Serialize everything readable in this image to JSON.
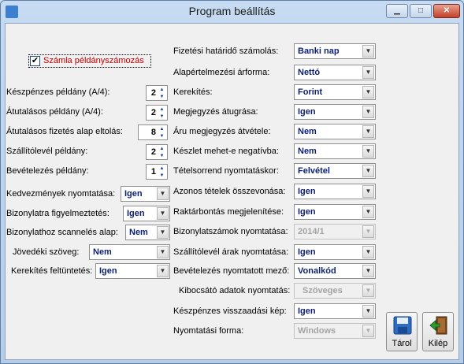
{
  "window": {
    "title": "Program beállítás"
  },
  "left": {
    "szamla_checkbox": {
      "label": "Számla példányszámozás",
      "checked": true
    },
    "spins": [
      {
        "label": "Készpénzes példány (A/4):",
        "value": "2"
      },
      {
        "label": "Átutalásos példány (A/4):",
        "value": "2"
      },
      {
        "label": "Átutalásos fizetés alap eltolás:",
        "value": "8"
      },
      {
        "label": "Szállítólevél példány:",
        "value": "2"
      },
      {
        "label": "Bevételezés példány:",
        "value": "1"
      }
    ],
    "dropdowns": [
      {
        "label": "Kedvezmények nyomtatása:",
        "value": "Igen"
      },
      {
        "label": "Bizonylatra figyelmeztetés:",
        "value": "Igen"
      },
      {
        "label": "Bizonylathoz scannelés alap:",
        "value": "Nem"
      },
      {
        "label": "Jövedéki szöveg:",
        "value": "Nem"
      },
      {
        "label": "Kerekítés feltüntetés:",
        "value": "Igen"
      }
    ]
  },
  "right": {
    "dropdowns": [
      {
        "label": "Fizetési határidő számolás:",
        "value": "Banki nap"
      },
      {
        "label": "Alapértelmezési árforma:",
        "value": "Nettó"
      },
      {
        "label": "Kerekítés:",
        "value": "Forint"
      },
      {
        "label": "Megjegyzés átugrása:",
        "value": "Igen"
      },
      {
        "label": "Áru megjegyzés átvétele:",
        "value": "Nem"
      },
      {
        "label": "Készlet mehet-e negatívba:",
        "value": "Nem"
      },
      {
        "label": "Tételsorrend nyomtatáskor:",
        "value": "Felvétel"
      },
      {
        "label": "Azonos tételek összevonása:",
        "value": "Igen"
      },
      {
        "label": "Raktárbontás megjelenítése:",
        "value": "Igen"
      },
      {
        "label": "Bizonylatszámok nyomtatása:",
        "value": "2014/1",
        "disabled": true
      },
      {
        "label": "Szállítólevél árak nyomtatása:",
        "value": "Igen"
      },
      {
        "label": "Bevételezés nyomtatott mező:",
        "value": "Vonalkód"
      },
      {
        "label": "Kibocsátó adatok nyomtatás:",
        "value": "Szöveges",
        "disabled": true
      },
      {
        "label": "Készpénzes visszaadási kép:",
        "value": "Igen"
      },
      {
        "label": "Nyomtatási forma:",
        "value": "Windows",
        "disabled": true
      }
    ]
  },
  "buttons": {
    "save": "Tárol",
    "exit": "Kilép"
  },
  "colors": {
    "value_text": "#0c1f6e",
    "checkbox_label": "#c00000"
  }
}
